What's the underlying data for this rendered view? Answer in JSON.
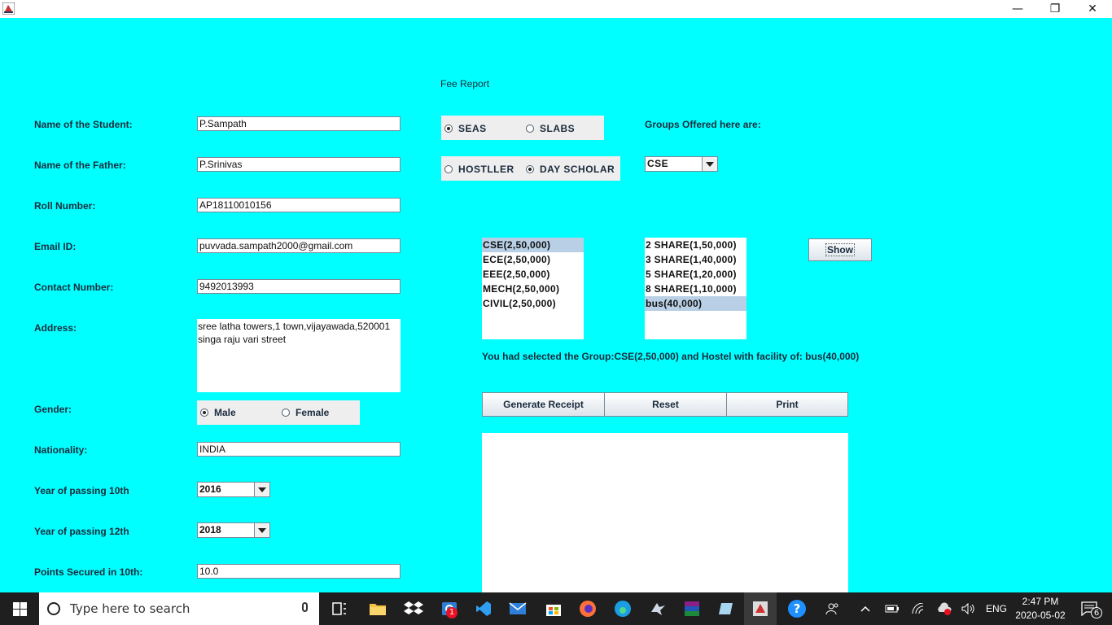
{
  "window": {
    "minimize_glyph": "—",
    "maximize_glyph": "❐",
    "close_glyph": "✕"
  },
  "form": {
    "heading": "Fee Report",
    "student_name": {
      "label": "Name of the Student:",
      "value": "P.Sampath"
    },
    "father_name": {
      "label": "Name of the Father:",
      "value": "P.Srinivas"
    },
    "roll_number": {
      "label": "Roll Number:",
      "value": "AP18110010156"
    },
    "email": {
      "label": "Email ID:",
      "value": "puvvada.sampath2000@gmail.com"
    },
    "contact": {
      "label": "Contact Number:",
      "value": "9492013993"
    },
    "address": {
      "label": "Address:",
      "value": "sree latha towers,1 town,vijayawada,520001\nsinga raju vari street"
    },
    "gender": {
      "label": "Gender:",
      "options": [
        "Male",
        "Female"
      ],
      "selected": "Male"
    },
    "nationality": {
      "label": "Nationality:",
      "value": "INDIA"
    },
    "year_10th": {
      "label": "Year of passing 10th",
      "value": "2016"
    },
    "year_12th": {
      "label": "Year of passing 12th",
      "value": "2018"
    },
    "points_10th": {
      "label": "Points Secured in 10th:",
      "value": "10.0"
    }
  },
  "school": {
    "options": [
      "SEAS",
      "SLABS"
    ],
    "selected": "SEAS"
  },
  "residence": {
    "options": [
      "HOSTLLER",
      "DAY SCHOLAR"
    ],
    "selected": "DAY SCHOLAR"
  },
  "groups": {
    "label": "Groups Offered here are:",
    "combo_value": "CSE",
    "list": [
      "CSE(2,50,000)",
      "ECE(2,50,000)",
      "EEE(2,50,000)",
      "MECH(2,50,000)",
      "CIVIL(2,50,000)"
    ],
    "selected_index": 0
  },
  "hostel": {
    "list": [
      "2 SHARE(1,50,000)",
      "3 SHARE(1,40,000)",
      "5 SHARE(1,20,000)",
      "8 SHARE(1,10,000)",
      "bus(40,000)"
    ],
    "selected_index": 4
  },
  "show_button": "Show",
  "selection_message": "You had selected the Group:CSE(2,50,000) and Hostel with facility of: bus(40,000)",
  "actions": {
    "generate": "Generate Receipt",
    "reset": "Reset",
    "print": "Print"
  },
  "receipt_output": "",
  "taskbar": {
    "search_placeholder": "Type here to search",
    "mail_badge": "1",
    "language": "ENG",
    "time": "2:47 PM",
    "date": "2020-05-02",
    "notification_count": "6"
  }
}
